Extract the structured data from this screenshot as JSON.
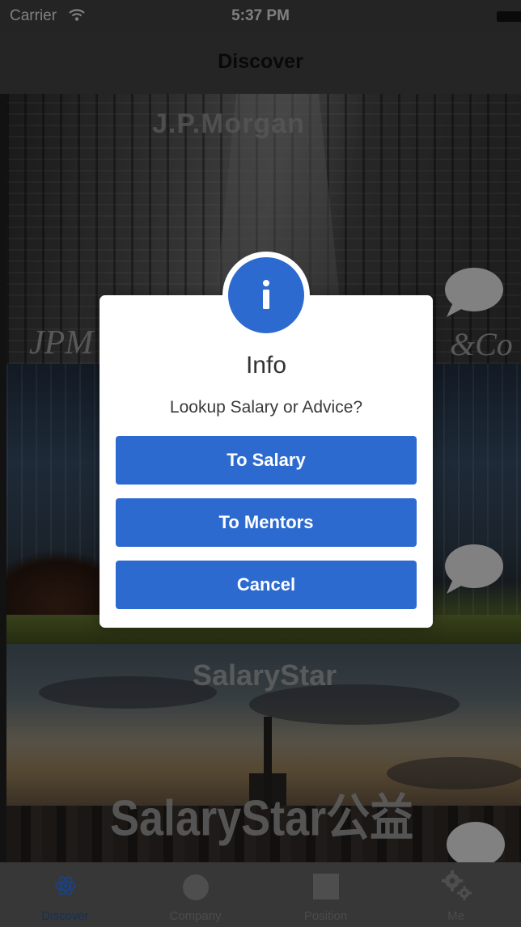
{
  "status_bar": {
    "carrier": "Carrier",
    "time": "5:37 PM"
  },
  "nav_bar": {
    "title": "Discover"
  },
  "cards": [
    {
      "image": "office-towers-photo",
      "signage": [
        "J.P.Morgan",
        "JPM",
        "&Co"
      ]
    },
    {
      "image": "glass-office-building-photo"
    },
    {
      "image": "city-skyline-sunset-photo",
      "watermark_top": "SalaryStar",
      "watermark_main": "SalaryStar公益"
    }
  ],
  "dialog": {
    "icon": "info-icon",
    "title": "Info",
    "message": "Lookup Salary or Advice?",
    "buttons": {
      "salary": "To Salary",
      "mentors": "To Mentors",
      "cancel": "Cancel"
    },
    "accent_color": "#2d6ad0"
  },
  "tab_bar": {
    "active_color": "#1f4f8f",
    "tabs": [
      {
        "label": "Discover",
        "icon": "atom-icon",
        "active": true
      },
      {
        "label": "Company",
        "icon": "circle-icon",
        "active": false
      },
      {
        "label": "Position",
        "icon": "square-icon",
        "active": false
      },
      {
        "label": "Me",
        "icon": "gear-icon",
        "active": false
      }
    ]
  }
}
